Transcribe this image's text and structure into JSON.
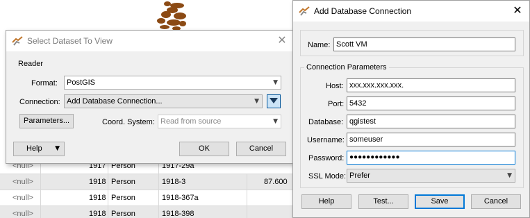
{
  "background_table": {
    "rows": [
      {
        "null": "<null>",
        "id": "1917",
        "type": "Person",
        "ref": "1917-29a",
        "value": ""
      },
      {
        "null": "<null>",
        "id": "1918",
        "type": "Person",
        "ref": "1918-3",
        "value": "87.600"
      },
      {
        "null": "<null>",
        "id": "1918",
        "type": "Person",
        "ref": "1918-367a",
        "value": ""
      },
      {
        "null": "<null>",
        "id": "1918",
        "type": "Person",
        "ref": "1918-398",
        "value": ""
      }
    ]
  },
  "select_dataset_dialog": {
    "title": "Select Dataset To View",
    "close_glyph": "✕",
    "reader_group_label": "Reader",
    "format_label": "Format:",
    "format_value": "PostGIS",
    "connection_label": "Connection:",
    "connection_value": "Add Database Connection...",
    "parameters_button": "Parameters...",
    "coord_system_label": "Coord. System:",
    "coord_system_value": "Read from source",
    "help_button": "Help",
    "ok_button": "OK",
    "cancel_button": "Cancel"
  },
  "add_db_dialog": {
    "title": "Add Database Connection",
    "close_glyph": "✕",
    "name_label": "Name:",
    "name_value": "Scott VM",
    "params_group_label": "Connection Parameters",
    "host_label": "Host:",
    "host_value": "xxx.xxx.xxx.xxx.",
    "port_label": "Port:",
    "port_value": "5432",
    "database_label": "Database:",
    "database_value": "qgistest",
    "username_label": "Username:",
    "username_value": "someuser",
    "password_label": "Password:",
    "password_value": "●●●●●●●●●●●●",
    "ssl_mode_label": "SSL Mode:",
    "ssl_mode_value": "Prefer",
    "help_button": "Help",
    "test_button": "Test...",
    "save_button": "Save",
    "cancel_button": "Cancel"
  },
  "icons": {
    "dropdown_arrow": "▼",
    "app_icon": "fme-transformer-icon"
  },
  "colors": {
    "accent": "#0078d7",
    "map_feature": "#8b4a14"
  }
}
